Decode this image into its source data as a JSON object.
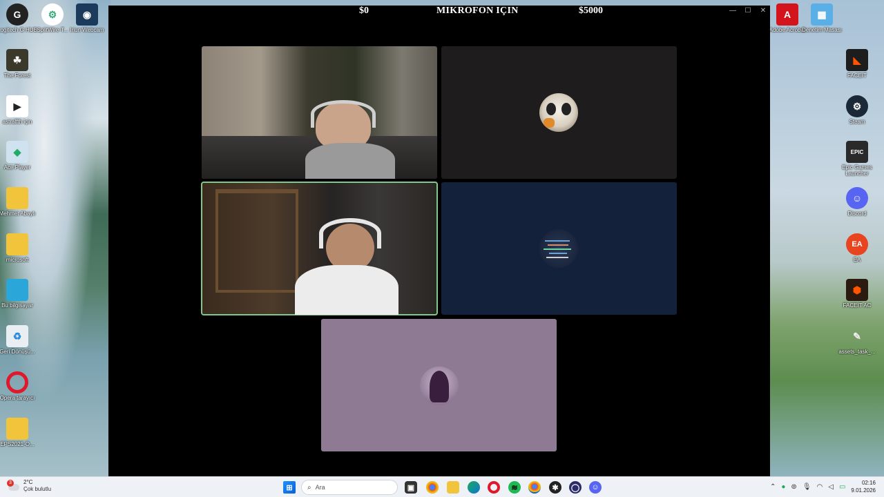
{
  "app": {
    "amount_left": "$0",
    "title": "MIKROFON IÇIN",
    "amount_right": "$5000",
    "controls": {
      "minimize": "—",
      "maximize": "☐",
      "close": "✕"
    }
  },
  "desktop_icons_left": [
    {
      "label": "Logitech G HUB",
      "icon": "logitech-icon"
    },
    {
      "label": "SplitWire-T...",
      "icon": "splitwire-icon"
    },
    {
      "label": "Iriun Webcam",
      "icon": "webcam-icon"
    },
    {
      "label": "The Forest",
      "icon": "game-icon"
    },
    {
      "label": "astralfth için",
      "icon": "video-file-icon"
    },
    {
      "label": "Ace Player",
      "icon": "ace-player-icon"
    },
    {
      "label": "Mehmet Abaylı",
      "icon": "folder-icon"
    },
    {
      "label": "microsoft",
      "icon": "folder-icon"
    },
    {
      "label": "Bu bilgisayar",
      "icon": "computer-icon"
    },
    {
      "label": "Geri Dönüşü...",
      "icon": "recycle-bin-icon"
    },
    {
      "label": "Opera tarayıcı",
      "icon": "opera-icon"
    },
    {
      "label": "EPS2021-O...",
      "icon": "folder-icon"
    }
  ],
  "desktop_icons_right": [
    {
      "label": "Adobe Acrobat",
      "icon": "acrobat-icon"
    },
    {
      "label": "Denetim Masası",
      "icon": "control-panel-icon"
    },
    {
      "label": "FACEIT",
      "icon": "faceit-icon"
    },
    {
      "label": "Steam",
      "icon": "steam-icon"
    },
    {
      "label": "Epic Games Launcher",
      "icon": "epic-games-icon"
    },
    {
      "label": "Discord",
      "icon": "discord-icon"
    },
    {
      "label": "EA",
      "icon": "ea-icon"
    },
    {
      "label": "FACEIT AC",
      "icon": "faceit-ac-icon"
    },
    {
      "label": "assets_task_...",
      "icon": "file-icon"
    }
  ],
  "taskbar": {
    "weather_temp": "2°C",
    "weather_cond": "Çok bulutlu",
    "weather_badge": "3",
    "search_placeholder": "Ara",
    "time": "02:16",
    "date": "9.01.2026"
  },
  "colors": {
    "speaking_outline": "#7fc98b",
    "tile_dark": "#1e1c1d",
    "tile_navy": "#13213a",
    "tile_lavender": "#8e7a93"
  }
}
